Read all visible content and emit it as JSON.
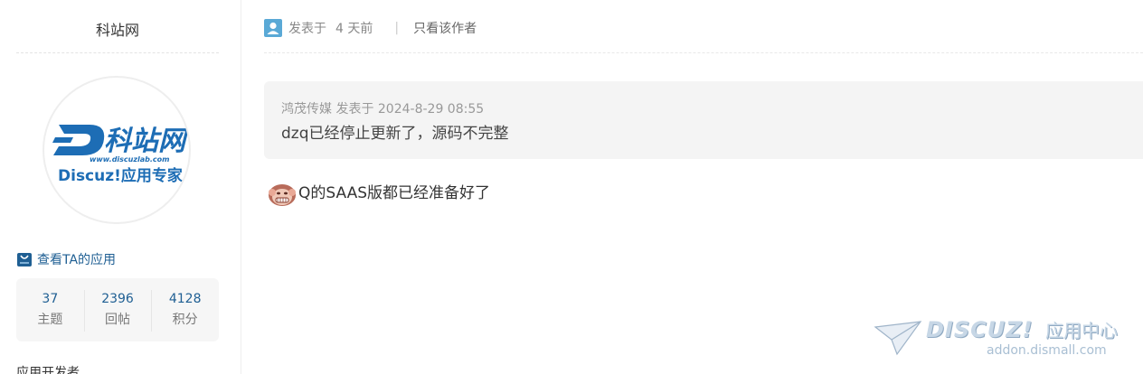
{
  "profile": {
    "username": "科站网",
    "avatar_logo_text": "科站网",
    "avatar_logo_letter": "D",
    "avatar_url_text": "www.discuzlab.com",
    "avatar_slogan": "Discuz!应用专家",
    "app_link_label": "查看TA的应用",
    "stats": [
      {
        "value": "37",
        "label": "主题"
      },
      {
        "value": "2396",
        "label": "回帖"
      },
      {
        "value": "4128",
        "label": "积分"
      }
    ],
    "role": "应用开发者"
  },
  "post": {
    "posted_label": "发表于",
    "time": "4 天前",
    "separator": "|",
    "author_only": "只看该作者",
    "quote": {
      "header": "鸿茂传媒 发表于 2024-8-29 08:55",
      "body": "dzq已经停止更新了，源码不完整"
    },
    "reply_text": "Q的SAAS版都已经准备好了",
    "emoji_icon": "monkey-emoji-icon"
  },
  "watermark": {
    "brand": "DISCUZ!",
    "center": "应用中心",
    "domain": "addon.dismall.com"
  },
  "colors": {
    "link_blue": "#1f5f93",
    "logo_blue": "#1d6db5",
    "quote_bg": "#f4f4f4"
  }
}
